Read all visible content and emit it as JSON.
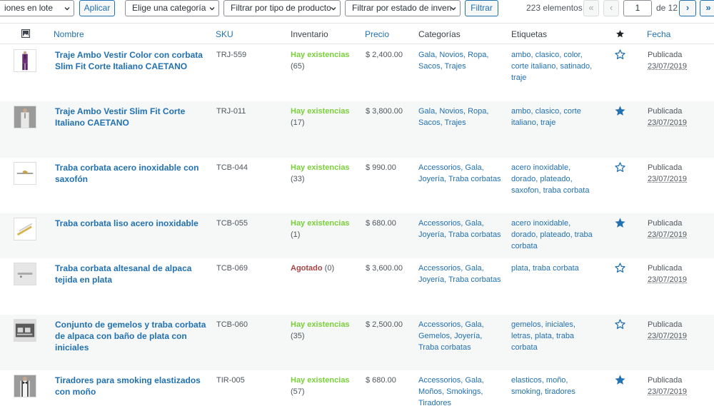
{
  "toolbar": {
    "bulk_actions": "iones en lote",
    "apply": "Aplicar",
    "category_filter": "Elige una categoría",
    "type_filter": "Filtrar por tipo de producto",
    "stock_filter": "Filtrar por estado de inven",
    "filter": "Filtrar",
    "items_count": "223 elementos",
    "first_page": "«",
    "prev_page": "‹",
    "current_page": "1",
    "of_pages": "de 12",
    "next_page": "›",
    "last_page": "»"
  },
  "headers": {
    "image_icon": "image-icon",
    "name": "Nombre",
    "sku": "SKU",
    "stock": "Inventario",
    "price": "Precio",
    "categories": "Categorías",
    "tags": "Etiquetas",
    "featured_icon": "star-icon",
    "date": "Fecha"
  },
  "colors": {
    "link": "#2271b1",
    "in_stock": "#7ad03a",
    "out_of_stock": "#aa4444",
    "row_alt": "#f6f7f7"
  },
  "rows": [
    {
      "name": "Traje Ambo Vestir Color con corbata Slim Fit Corte Italiano CAETANO",
      "sku": "TRJ-559",
      "stock_status": "Hay existencias",
      "stock_qty": "(65)",
      "price": "$ 2,400.00",
      "categories": "Gala, Novios, Ropa, Sacos, Trajes",
      "tags": "ambo, clasico, color, corte italiano, satinado, traje",
      "featured": false,
      "status": "Publicada",
      "date": "23/07/2019",
      "thumb": "purple-suit"
    },
    {
      "name": "Traje Ambo Vestir Slim Fit Corte Italiano CAETANO",
      "sku": "TRJ-011",
      "stock_status": "Hay existencias",
      "stock_qty": "(17)",
      "price": "$ 3,800.00",
      "categories": "Gala, Novios, Ropa, Sacos, Trajes",
      "tags": "ambo, clasico, corte italiano, traje",
      "featured": true,
      "status": "Publicada",
      "date": "23/07/2019",
      "thumb": "grey-suit"
    },
    {
      "name": "Traba corbata acero inoxidable con saxofón",
      "sku": "TCB-044",
      "stock_status": "Hay existencias",
      "stock_qty": "(33)",
      "price": "$ 990.00",
      "categories": "Accessorios, Gala, Joyería, Traba corbatas",
      "tags": "acero inoxidable, dorado, plateado, saxofon, traba corbata",
      "featured": false,
      "status": "Publicada",
      "date": "23/07/2019",
      "thumb": "tie-clip-sax"
    },
    {
      "name": "Traba corbata liso acero inoxidable",
      "sku": "TCB-055",
      "stock_status": "Hay existencias",
      "stock_qty": "(1)",
      "price": "$ 680.00",
      "categories": "Accessorios, Gala, Joyería, Traba corbatas",
      "tags": "acero inoxidable, dorado, plateado, traba corbata",
      "featured": true,
      "status": "Publicada",
      "date": "23/07/2019",
      "thumb": "tie-clip-gold"
    },
    {
      "name": "Traba corbata altesanal de alpaca tejida en plata",
      "sku": "TCB-069",
      "stock_status": "Agotado",
      "stock_qty": "(0)",
      "price": "$ 3,600.00",
      "categories": "Accessorios, Gala, Joyería, Traba corbatas",
      "tags": "plata, traba corbata",
      "featured": false,
      "status": "Publicada",
      "date": "23/07/2019",
      "thumb": "tie-clip-silver"
    },
    {
      "name": "Conjunto de gemelos y traba corbata de alpaca con baño de plata con iniciales",
      "sku": "TCB-060",
      "stock_status": "Hay existencias",
      "stock_qty": "(35)",
      "price": "$ 2,500.00",
      "categories": "Accessorios, Gala, Gemelos, Joyería, Traba corbatas",
      "tags": "gemelos, iniciales, letras, plata, traba corbata",
      "featured": false,
      "status": "Publicada",
      "date": "23/07/2019",
      "thumb": "cufflinks-set"
    },
    {
      "name": "Tiradores para smoking elastizados con moño",
      "sku": "TIR-005",
      "stock_status": "Hay existencias",
      "stock_qty": "(57)",
      "price": "$ 680.00",
      "categories": "Accessorios, Gala, Moños, Smokings, Tiradores",
      "tags": "elasticos, moño, smoking, tiradores",
      "featured": true,
      "status": "Publicada",
      "date": "23/07/2019",
      "thumb": "suspenders"
    }
  ]
}
